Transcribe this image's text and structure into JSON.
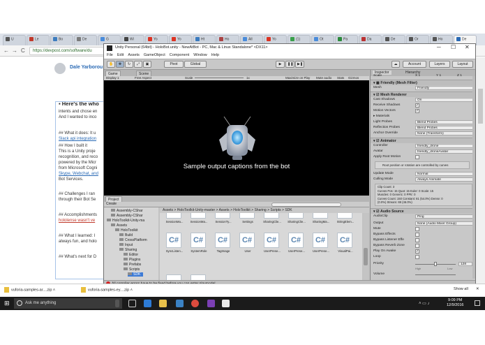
{
  "browser": {
    "tabs": [
      {
        "label": "U",
        "color": "#555"
      },
      {
        "label": "Le",
        "color": "#c0392b"
      },
      {
        "label": "Bo",
        "color": "#3d7dbf"
      },
      {
        "label": "De",
        "color": "#7b7b7b"
      },
      {
        "label": "G",
        "color": "#4a8cdb"
      },
      {
        "label": "Wi",
        "color": "#444"
      },
      {
        "label": "Yo",
        "color": "#d32"
      },
      {
        "label": "Yo",
        "color": "#d32"
      },
      {
        "label": "Ht",
        "color": "#3a7bbf"
      },
      {
        "label": "Ho",
        "color": "#a44"
      },
      {
        "label": "All",
        "color": "#4a8cdb"
      },
      {
        "label": "Yo",
        "color": "#d32"
      },
      {
        "label": "(1)",
        "color": "#3aa04b"
      },
      {
        "label": "Ot",
        "color": "#4a8cdb"
      },
      {
        "label": "Pa",
        "color": "#2c8a3c"
      },
      {
        "label": "Da",
        "color": "#b33"
      },
      {
        "label": "De",
        "color": "#555"
      },
      {
        "label": "Or",
        "color": "#555"
      },
      {
        "label": "Ho",
        "color": "#555"
      },
      {
        "label": "De",
        "color": "#2a6ab5"
      }
    ],
    "url": "https://devpost.com/software/du",
    "nav": {
      "back": "←",
      "forward": "→",
      "reload": "C"
    }
  },
  "page": {
    "author": "Dale Yarborou",
    "heading": "Here's the who",
    "lines": [
      {
        "text": "intents and chose en",
        "style": "normal"
      },
      {
        "text": "And I wanted to inco",
        "style": "normal"
      },
      {
        "text": "## What it does: It u",
        "style": "normal"
      },
      {
        "text": "Slack api integration",
        "style": "link"
      },
      {
        "text": "## How I built it",
        "style": "normal"
      },
      {
        "text": "This is a Unity proje",
        "style": "normal"
      },
      {
        "text": "recognition, and reco",
        "style": "normal"
      },
      {
        "text": "powered by the Micr",
        "style": "normal"
      },
      {
        "text": "from Microsoft Cogni",
        "style": "normal"
      },
      {
        "text": "Skype, Webchat, and",
        "style": "link"
      },
      {
        "text": "Bot Services.",
        "style": "normal"
      },
      {
        "text": "## Challenges I ran",
        "style": "normal"
      },
      {
        "text": "through their Bot Se",
        "style": "normal"
      },
      {
        "text": "## Accomplishments",
        "style": "normal"
      },
      {
        "text": "hololense wasn't ve",
        "style": "red"
      },
      {
        "text": "## What I learned: I",
        "style": "normal"
      },
      {
        "text": "always fun, and holo",
        "style": "normal"
      },
      {
        "text": "## What's next for D",
        "style": "normal"
      }
    ]
  },
  "unity": {
    "title": "Unity Personal (64bit) - HoloBot.unity - NewAtBot - PC, Mac & Linux Standalone* <DX11>",
    "window_controls": {
      "minimize": "─",
      "maximize": "☐",
      "close": "✕"
    },
    "menu": [
      "File",
      "Edit",
      "Assets",
      "GameObject",
      "Component",
      "Window",
      "Help"
    ],
    "toolbar": {
      "pivot": "Pivot",
      "global": "Global",
      "play": "▶",
      "pause": "❚❚",
      "step": "▶❚",
      "cloud": "☁",
      "account": "Account",
      "layers": "Layers",
      "layout": "Layout"
    },
    "game": {
      "tab_game": "Game",
      "tab_scene": "Scene",
      "display": "Display 1",
      "aspect": "Free Aspect",
      "scale_label": "Scale",
      "scale_value": "1x",
      "maximize": "Maximize on Play",
      "mute": "Mute audio",
      "stats": "Stats",
      "gizmos": "Gizmos",
      "caption": "Sample output captions from the bot"
    },
    "project": {
      "tab": "Project",
      "create": "Create",
      "breadcrumb": "Assets > HoloToolkit-Unity-master > Assets > HoloToolkit > Sharing > Scripts > SDK",
      "tree": [
        {
          "label": "Assembly-CShar",
          "indent": 1
        },
        {
          "label": "Assembly-CShar",
          "indent": 1
        },
        {
          "label": "HoloToolkit-Unity-ma",
          "indent": 0
        },
        {
          "label": "Assets",
          "indent": 1
        },
        {
          "label": "HoloToolkit",
          "indent": 2
        },
        {
          "label": "Build",
          "indent": 3
        },
        {
          "label": "CrossPlatform",
          "indent": 3
        },
        {
          "label": "Input",
          "indent": 3
        },
        {
          "label": "Sharing",
          "indent": 3
        },
        {
          "label": "Editor",
          "indent": 4
        },
        {
          "label": "Plugins",
          "indent": 4
        },
        {
          "label": "Prefabs",
          "indent": 4
        },
        {
          "label": "Scripts",
          "indent": 4
        },
        {
          "label": "SDK",
          "indent": 5
        }
      ],
      "assets": [
        "SessionMa...",
        "SessionMa...",
        "SessionTy...",
        "Settings",
        "SharingClie...",
        "SharingClie...",
        "SharingMa...",
        "StringElem...",
        "SyncListen...",
        "SystemRole",
        "TagImage",
        "User",
        "UserPrese...",
        "UserPrese...",
        "UserPrese...",
        "VisualPai..."
      ],
      "asset_glyph": "C#"
    },
    "status": "All compiler errors have to be fixed before you can enter playmode!",
    "inspector": {
      "tab_inspector": "Inspector",
      "tab_hierarchy": "Hierarchy",
      "scale_label": "Scale",
      "scale_x": "X 1",
      "scale_y": "Y 1",
      "scale_z": "Z 1",
      "mesh_filter": "Friendly (Mesh Filter)",
      "mesh_label": "Mesh",
      "mesh_value": "Friendly",
      "mesh_renderer": "Mesh Renderer",
      "cast_shadows_label": "Cast Shadows",
      "cast_shadows_value": "On",
      "receive_shadows": "Receive Shadows",
      "motion_vectors": "Motion Vectors",
      "materials": "Materials",
      "light_probes_label": "Light Probes",
      "light_probes_value": "Blend Probes",
      "reflection_probes_label": "Reflection Probes",
      "reflection_probes_value": "Blend Probes",
      "anchor_override_label": "Anchor Override",
      "anchor_override_value": "None (Transform)",
      "animator": "Animator",
      "controller_label": "Controller",
      "controller_value": "friendly_drone",
      "avatar_label": "Avatar",
      "avatar_value": "friendly_droneAvatar",
      "apply_root_motion": "Apply Root Motion",
      "root_note": "Root position or rotation are controlled by curves",
      "update_mode_label": "Update Mode",
      "update_mode_value": "Normal",
      "culling_mode_label": "Culling Mode",
      "culling_mode_value": "Always Animate",
      "clip_info": [
        "Clip Count: 3",
        "Curves Pos: 15 Quat: 15 Euler: 0 Scale: 15",
        "Muscles: 0 Generic: 0 PPtr: 0",
        "Curves Count: 150 Constant: 81 (54.0%) Dense: 0",
        "(0.0%) Stream: 69 (46.0%)"
      ],
      "audio_source": "Audio Source",
      "audioclip_label": "AudioClip",
      "audioclip_value": "Ping",
      "output_label": "Output",
      "output_value": "None (Audio Mixer Group)",
      "mute": "Mute",
      "bypass_effects": "Bypass Effects",
      "bypass_listener": "Bypass Listener Effe",
      "bypass_reverb": "Bypass Reverb Zone",
      "play_on_awake": "Play On Awake",
      "loop": "Loop",
      "priority_label": "Priority",
      "priority_value": "128",
      "priority_high": "High",
      "priority_low": "Low",
      "volume_label": "Volume"
    }
  },
  "downloads": {
    "items": [
      "vuforia-samples-ar....zip",
      "vuforia-samples-ey....zip"
    ],
    "show_all": "Show all"
  },
  "taskbar": {
    "search_placeholder": "Ask me anything",
    "time": "9:09 PM",
    "date": "12/9/2016"
  }
}
